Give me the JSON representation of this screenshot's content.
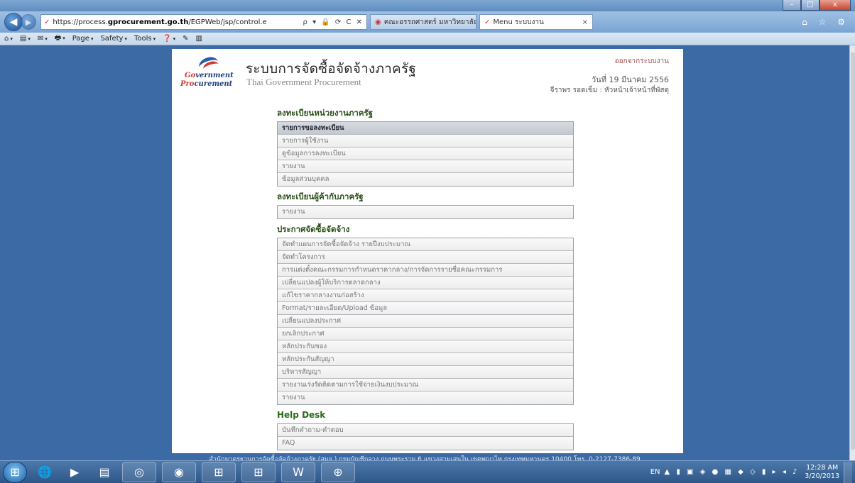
{
  "browser": {
    "title_buttons": {
      "minimize": "–",
      "maximize": "□",
      "close": "x"
    },
    "address_prefix": "https://process.",
    "address_bold": "gprocurement.go.th",
    "address_suffix": "/EGPWeb/jsp/control.e",
    "address_tools": "ρ ▾ 🔒 ⟳ C ✕",
    "tabs": [
      {
        "label": "คณะอรรถศาสตร์ มหาวิทยาลัยธรรมรัฐ",
        "active": false
      },
      {
        "label": "Menu ระบบงาน",
        "active": true
      }
    ],
    "tab_close": "×",
    "right_icons": "⌂ ☆ ⚙",
    "command_bar": [
      {
        "label": "⌂",
        "caret": "▾"
      },
      {
        "label": "▤",
        "caret": "▾"
      },
      {
        "label": "✉",
        "caret": "▾"
      },
      {
        "label": "🖶",
        "caret": "▾"
      },
      {
        "label": "Page",
        "caret": "▾"
      },
      {
        "label": "Safety",
        "caret": "▾"
      },
      {
        "label": "Tools",
        "caret": "▾"
      },
      {
        "label": "❓",
        "caret": "▾"
      },
      {
        "label": "✎",
        "caret": ""
      },
      {
        "label": "▥",
        "caret": ""
      }
    ]
  },
  "header": {
    "logo_line1_a": "G",
    "logo_line1_b": "vernment",
    "logo_line2_a": "Pro",
    "logo_line2_b": "curement",
    "title_th": "ระบบการจัดซื้อจัดจ้างภาครัฐ",
    "title_en": "Thai Government Procurement",
    "logout": "ออกจากระบบงาน",
    "date": "วันที่ 19 มีนาคม 2556",
    "user": "จีราพร รอดเข็ม : หัวหน้าเจ้าหน้าที่พัสดุ"
  },
  "menu": {
    "sections": [
      {
        "title": "ลงทะเบียนหน่วยงานภาครัฐ",
        "items": [
          {
            "label": "รายการขอลงทะเบียน",
            "header": true
          },
          {
            "label": "รายการผู้ใช้งาน"
          },
          {
            "label": "ดูข้อมูลการลงทะเบียน"
          },
          {
            "label": "รายงาน"
          },
          {
            "label": "ข้อมูลส่วนบุคคล"
          }
        ]
      },
      {
        "title": "ลงทะเบียนผู้ค้ากับภาครัฐ",
        "items": [
          {
            "label": "รายงาน"
          }
        ]
      },
      {
        "title": "ประกาศจัดซื้อจัดจ้าง",
        "items": [
          {
            "label": "จัดทำแผนการจัดซื้อจัดจ้าง รายปีงบประมาณ"
          },
          {
            "label": "จัดทำโครงการ"
          },
          {
            "label": "การแต่งตั้งคณะกรรมการกำหนดราคากลาง/การจัดการรายชื่อคณะกรรมการ"
          },
          {
            "label": "เปลี่ยนแปลงผู้ให้บริการตลาดกลาง"
          },
          {
            "label": "แก้ไขราคากลางงานก่อสร้าง"
          },
          {
            "label": "Format/รายละเอียด/Upload ข้อมูล"
          },
          {
            "label": "เปลี่ยนแปลงประกาศ"
          },
          {
            "label": "ยกเลิกประกาศ"
          },
          {
            "label": "หลักประกันซอง"
          },
          {
            "label": "หลักประกันสัญญา"
          },
          {
            "label": "บริหารสัญญา"
          },
          {
            "label": "รายงานเร่งรัดติดตามการใช้จ่ายเงินงบประมาณ"
          },
          {
            "label": "รายงาน"
          }
        ]
      },
      {
        "title": "Help Desk",
        "en": true,
        "items": [
          {
            "label": "บันทึกคำถาม-คำตอบ"
          },
          {
            "label": "FAQ"
          }
        ]
      }
    ]
  },
  "footer": "สำนักมาตรฐานการจัดซื้อจัดจ้างภาครัฐ (สมจ.) กรมบัญชีกลาง ถนนพระราม 6 แขวงสามเสนใน เขตพญาไท กรุงเทพมหานคร 10400 โทร. 0-2127-7386-89",
  "taskbar": {
    "apps": [
      "🌐",
      "▶",
      "▤",
      "◎",
      "◉",
      "⊞",
      "W",
      "⊕"
    ],
    "tray_lang": "EN",
    "tray_icons": "▲ ▮ ▣ ◈ ● ▦ ◆ ◇ ▮ ▸ ◂ ♪",
    "time": "12:28 AM",
    "date": "3/20/2013"
  },
  "colors": {
    "page_bg": "#3c6aa4",
    "section_title": "#2b4f1a",
    "logo_blue": "#1f3f7a",
    "logo_red": "#d33b2c"
  }
}
